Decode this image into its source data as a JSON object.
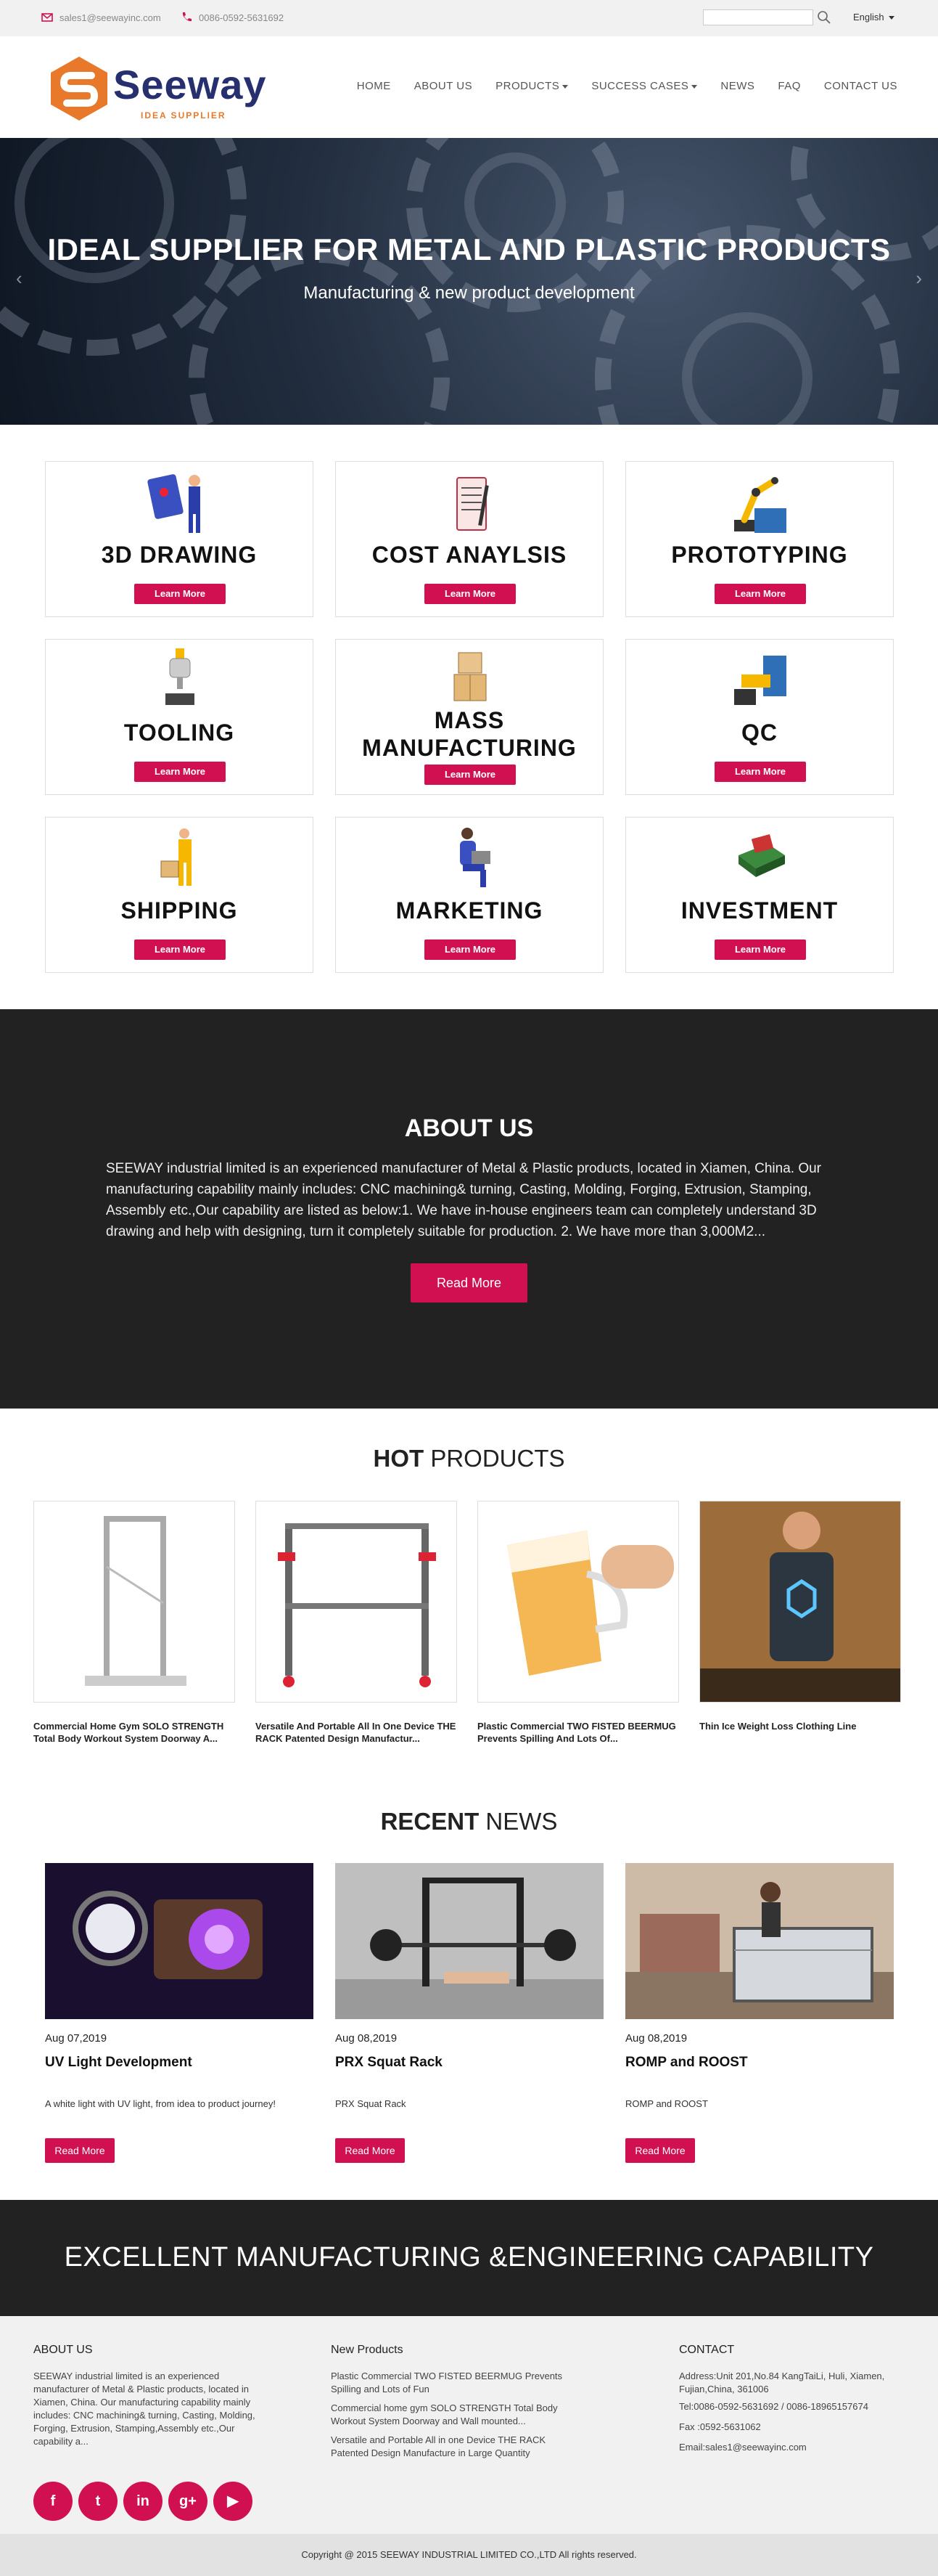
{
  "topbar": {
    "email": "sales1@seewayinc.com",
    "phone": "0086-0592-5631692",
    "search_placeholder": "",
    "language": "English"
  },
  "header": {
    "brand": "Seeway",
    "tagline": "IDEA SUPPLIER",
    "nav": [
      "HOME",
      "ABOUT US",
      "PRODUCTS",
      "SUCCESS CASES",
      "NEWS",
      "FAQ",
      "CONTACT US"
    ]
  },
  "hero": {
    "title": "IDEAL SUPPLIER FOR METAL AND PLASTIC PRODUCTS",
    "subtitle": "Manufacturing & new product development",
    "prev_arrow": "‹",
    "next_arrow": "›"
  },
  "services": [
    {
      "title": "3D DRAWING",
      "button": "Learn More",
      "icon": "designer-icon"
    },
    {
      "title": "COST ANAYLSIS",
      "button": "Learn More",
      "icon": "clipboard-icon"
    },
    {
      "title": "PROTOTYPING",
      "button": "Learn More",
      "icon": "robot-arm-icon"
    },
    {
      "title": "TOOLING",
      "button": "Learn More",
      "icon": "tool-chuck-icon"
    },
    {
      "title": "MASS MANUFACTURING",
      "button": "Learn More",
      "icon": "boxes-icon"
    },
    {
      "title": "QC",
      "button": "Learn More",
      "icon": "inspection-machine-icon"
    },
    {
      "title": "SHIPPING",
      "button": "Learn More",
      "icon": "delivery-worker-icon"
    },
    {
      "title": "MARKETING",
      "button": "Learn More",
      "icon": "laptop-user-icon"
    },
    {
      "title": "INVESTMENT",
      "button": "Learn More",
      "icon": "money-stack-icon"
    }
  ],
  "about": {
    "title": "ABOUT US",
    "text": "SEEWAY industrial limited is an experienced manufacturer of Metal & Plastic products, located in Xiamen, China. Our manufacturing capability mainly includes: CNC machining& turning, Casting, Molding, Forging, Extrusion, Stamping, Assembly etc.,Our capability are listed as below:1. We have in-house engineers team can completely understand 3D drawing and help with designing, turn it completely suitable for production. 2. We have more than 3,000M2...",
    "button": "Read More"
  },
  "hot_products": {
    "title_bold": "HOT",
    "title_rest": " PRODUCTS",
    "items": [
      {
        "name": "Commercial Home Gym SOLO STRENGTH Total Body Workout System Doorway A..."
      },
      {
        "name": "Versatile And Portable All In One Device THE RACK Patented Design Manufactur..."
      },
      {
        "name": "Plastic Commercial TWO FISTED BEERMUG Prevents Spilling And Lots Of..."
      },
      {
        "name": "Thin Ice Weight Loss Clothing Line"
      }
    ]
  },
  "recent_news": {
    "title_bold": "RECENT",
    "title_rest": " NEWS",
    "items": [
      {
        "date": "Aug 07,2019",
        "title": "UV Light Development",
        "desc": "A white light with UV light, from idea to product journey!",
        "button": "Read More"
      },
      {
        "date": "Aug 08,2019",
        "title": "PRX Squat Rack",
        "desc": "PRX Squat Rack",
        "button": "Read More"
      },
      {
        "date": "Aug 08,2019",
        "title": "ROMP and ROOST",
        "desc": "ROMP and ROOST",
        "button": "Read More"
      }
    ]
  },
  "banner": {
    "text": "EXCELLENT MANUFACTURING &ENGINEERING CAPABILITY"
  },
  "footer": {
    "about_title": "ABOUT US",
    "about_text": "SEEWAY industrial limited is an experienced manufacturer of Metal & Plastic products, located in Xiamen, China. Our manufacturing capability mainly includes: CNC machining& turning, Casting, Molding, Forging, Extrusion, Stamping,Assembly etc.,Our capability a...",
    "products_title": "New Products",
    "products": [
      "Plastic Commercial TWO FISTED BEERMUG Prevents Spilling and Lots of Fun",
      "Commercial home gym SOLO STRENGTH Total Body Workout System Doorway and Wall mounted...",
      "Versatile and Portable All in one Device THE RACK Patented Design Manufacture in Large Quantity"
    ],
    "contact_title": "CONTACT",
    "address": "Address:Unit 201,No.84 KangTaiLi, Huli, Xiamen, Fujian,China, 361006",
    "tel": "Tel:0086-0592-5631692 / 0086-18965157674",
    "fax": "Fax :0592-5631062",
    "email": "Email:sales1@seewayinc.com",
    "social": [
      "f",
      "t",
      "in",
      "g+",
      "▶"
    ],
    "copyright": "Copyright @ 2015 SEEWAY INDUSTRIAL LIMITED CO.,LTD All rights reserved."
  },
  "colors": {
    "accent": "#d01050",
    "brand_navy": "#27306f",
    "brand_orange": "#e8792a",
    "dark_section": "#222222"
  }
}
